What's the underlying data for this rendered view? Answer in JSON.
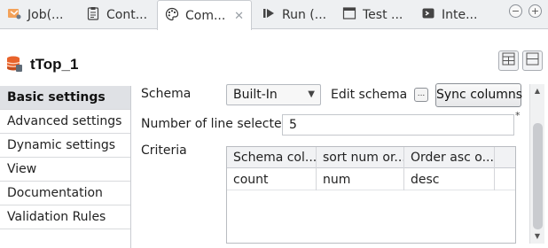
{
  "tabs": [
    {
      "label": "Job(...",
      "icon": "job-icon"
    },
    {
      "label": "Cont...",
      "icon": "clipboard-icon"
    },
    {
      "label": "Com...",
      "icon": "palette-icon",
      "active": true
    },
    {
      "label": "Run (...",
      "icon": "run-icon"
    },
    {
      "label": "Test ...",
      "icon": "test-window-icon"
    },
    {
      "label": "Inte...",
      "icon": "integration-icon"
    }
  ],
  "tab_close": "✕",
  "window_controls": {
    "minimize": "−",
    "maximize": "+"
  },
  "component": {
    "title": "tTop_1",
    "icon": "database-component-icon"
  },
  "sidenav": {
    "items": [
      {
        "label": "Basic settings",
        "selected": true
      },
      {
        "label": "Advanced settings"
      },
      {
        "label": "Dynamic settings"
      },
      {
        "label": "View"
      },
      {
        "label": "Documentation"
      },
      {
        "label": "Validation Rules"
      }
    ]
  },
  "form": {
    "schema_label": "Schema",
    "schema_value": "Built-In",
    "edit_schema_label": "Edit schema",
    "edit_schema_button": "...",
    "sync_columns_label": "Sync columns",
    "num_lines_label": "Number of line selected",
    "num_lines_value": "5",
    "required_marker": "*",
    "criteria_label": "Criteria"
  },
  "criteria_table": {
    "columns": [
      "Schema col...",
      "sort num or...",
      "Order asc o..."
    ],
    "rows": [
      [
        "count",
        "num",
        "desc"
      ]
    ]
  },
  "scrollbar": {
    "up": "▲",
    "down": "▼"
  },
  "colors": {
    "accent_orange": "#e8632b",
    "selected_bg": "#dfe1e5",
    "tab_bar_bg": "#eef0f2"
  }
}
